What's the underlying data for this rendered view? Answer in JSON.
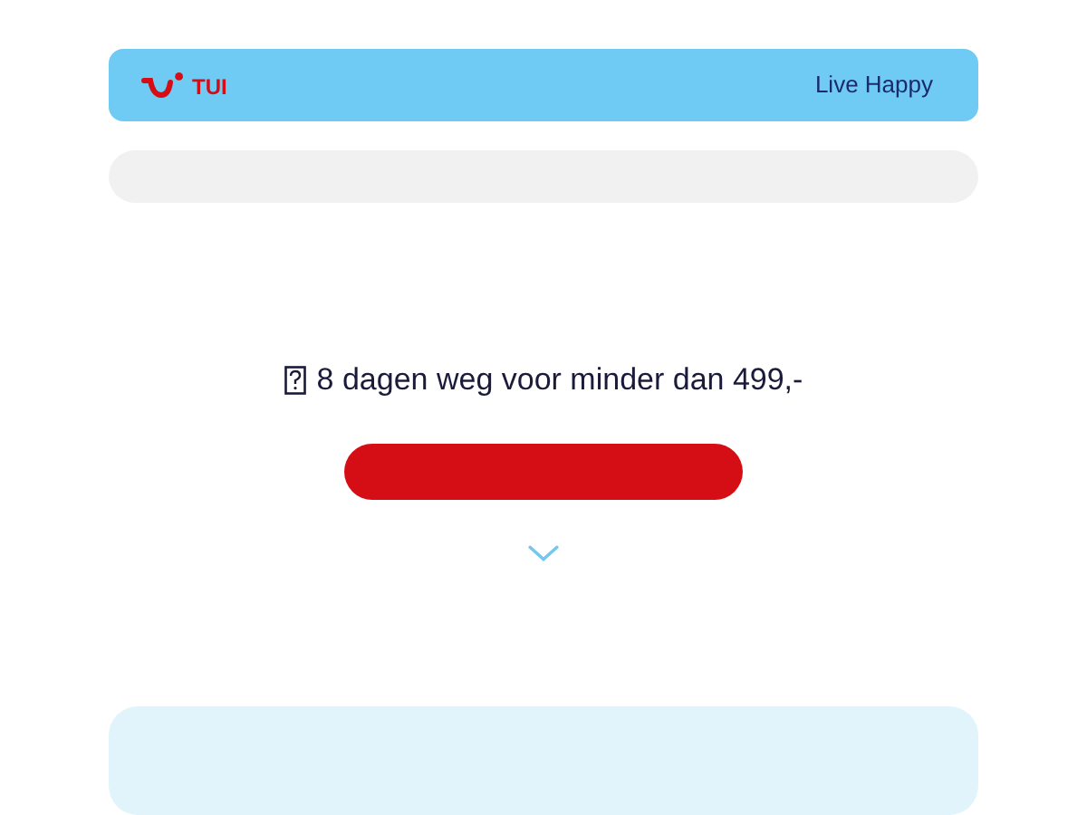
{
  "header": {
    "brand": "TUI",
    "tagline": "Live Happy"
  },
  "promo": {
    "text": "8 dagen weg voor minder dan 499,-"
  }
}
